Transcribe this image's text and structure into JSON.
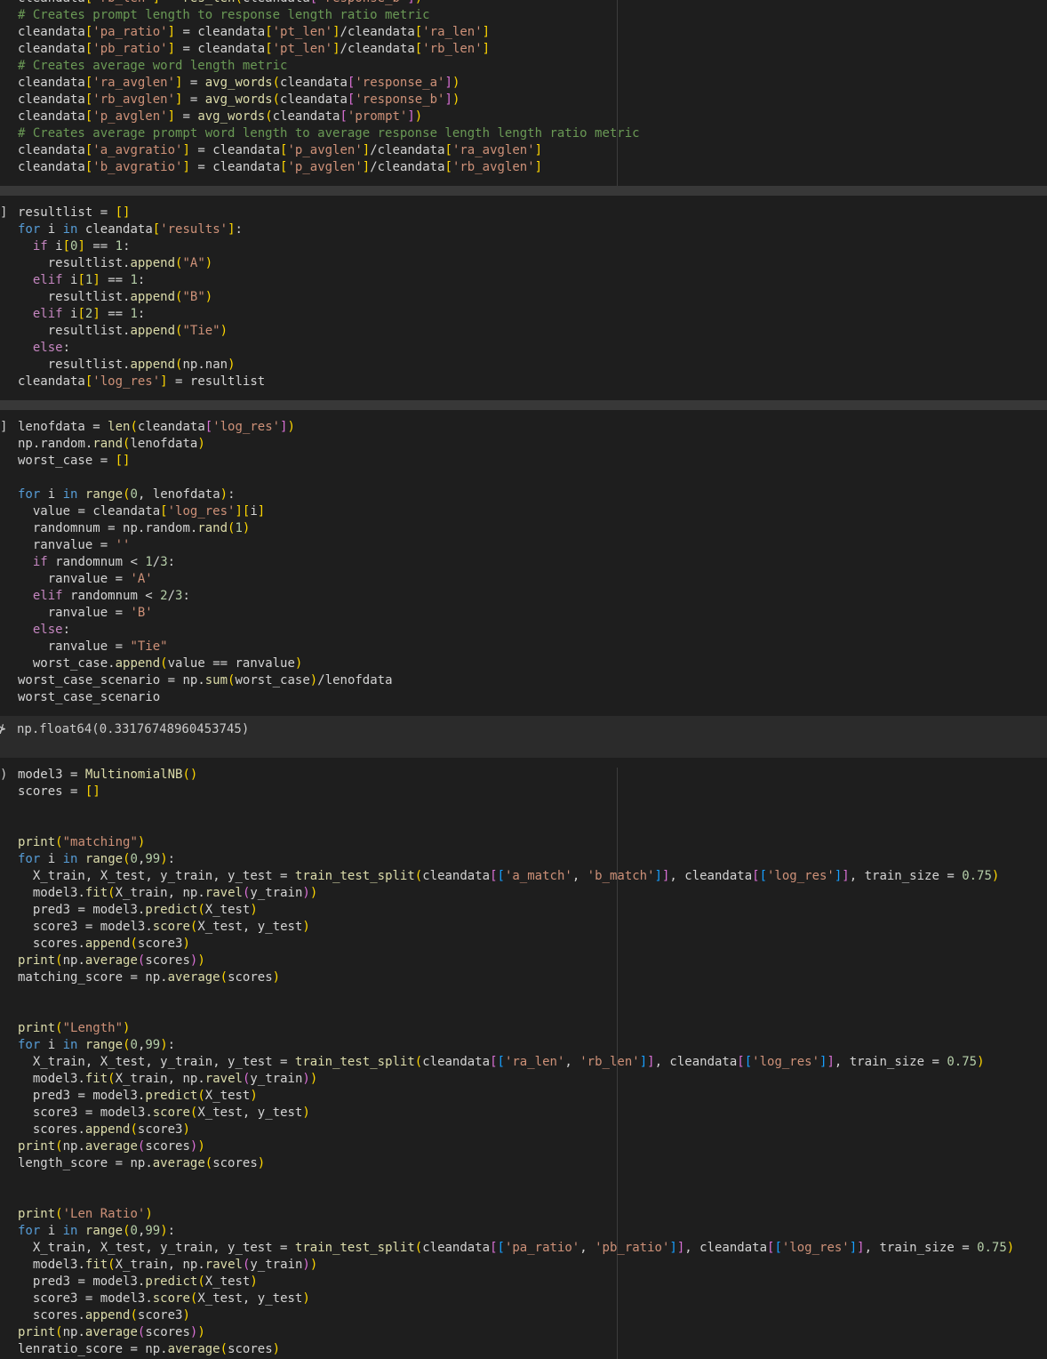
{
  "cell1": {
    "lines": [
      "cleandata['rb_len'] = res_len(cleandata['response_b'])",
      "# Creates prompt length to response length ratio metric",
      "cleandata['pa_ratio'] = cleandata['pt_len']/cleandata['ra_len']",
      "cleandata['pb_ratio'] = cleandata['pt_len']/cleandata['rb_len']",
      "# Creates average word length metric",
      "cleandata['ra_avglen'] = avg_words(cleandata['response_a'])",
      "cleandata['rb_avglen'] = avg_words(cleandata['response_b'])",
      "cleandata['p_avglen'] = avg_words(cleandata['prompt'])",
      "# Creates average prompt word length to average response length length ratio metric",
      "cleandata['a_avgratio'] = cleandata['p_avglen']/cleandata['ra_avglen']",
      "cleandata['b_avgratio'] = cleandata['p_avglen']/cleandata['rb_avglen']"
    ]
  },
  "cell2": {
    "gutter": "]",
    "lines": [
      "resultlist = []",
      "for i in cleandata['results']:",
      "  if i[0] == 1:",
      "    resultlist.append(\"A\")",
      "  elif i[1] == 1:",
      "    resultlist.append(\"B\")",
      "  elif i[2] == 1:",
      "    resultlist.append(\"Tie\")",
      "  else:",
      "    resultlist.append(np.nan)",
      "cleandata['log_res'] = resultlist"
    ]
  },
  "cell3": {
    "gutter": "]",
    "lines": [
      "lenofdata = len(cleandata['log_res'])",
      "np.random.rand(lenofdata)",
      "worst_case = []",
      "",
      "for i in range(0, lenofdata):",
      "  value = cleandata['log_res'][i]",
      "  randomnum = np.random.rand(1)",
      "  ranvalue = ''",
      "  if randomnum < 1/3:",
      "    ranvalue = 'A'",
      "  elif randomnum < 2/3:",
      "    ranvalue = 'B'",
      "  else:",
      "    ranvalue = \"Tie\"",
      "  worst_case.append(value == ranvalue)",
      "worst_case_scenario = np.sum(worst_case)/lenofdata",
      "worst_case_scenario"
    ],
    "output_gutter": "⊁",
    "output": "np.float64(0.33176748960453745)"
  },
  "cell4": {
    "gutter": ")",
    "lines": [
      "model3 = MultinomialNB()",
      "scores = []",
      "",
      "",
      "print(\"matching\")",
      "for i in range(0,99):",
      "  X_train, X_test, y_train, y_test = train_test_split(cleandata[['a_match', 'b_match']], cleandata[['log_res']], train_size = 0.75)",
      "  model3.fit(X_train, np.ravel(y_train))",
      "  pred3 = model3.predict(X_test)",
      "  score3 = model3.score(X_test, y_test)",
      "  scores.append(score3)",
      "print(np.average(scores))",
      "matching_score = np.average(scores)",
      "",
      "",
      "print(\"Length\")",
      "for i in range(0,99):",
      "  X_train, X_test, y_train, y_test = train_test_split(cleandata[['ra_len', 'rb_len']], cleandata[['log_res']], train_size = 0.75)",
      "  model3.fit(X_train, np.ravel(y_train))",
      "  pred3 = model3.predict(X_test)",
      "  score3 = model3.score(X_test, y_test)",
      "  scores.append(score3)",
      "print(np.average(scores))",
      "length_score = np.average(scores)",
      "",
      "",
      "print('Len Ratio')",
      "for i in range(0,99):",
      "  X_train, X_test, y_train, y_test = train_test_split(cleandata[['pa_ratio', 'pb_ratio']], cleandata[['log_res']], train_size = 0.75)",
      "  model3.fit(X_train, np.ravel(y_train))",
      "  pred3 = model3.predict(X_test)",
      "  score3 = model3.score(X_test, y_test)",
      "  scores.append(score3)",
      "print(np.average(scores))",
      "lenratio_score = np.average(scores)"
    ]
  }
}
